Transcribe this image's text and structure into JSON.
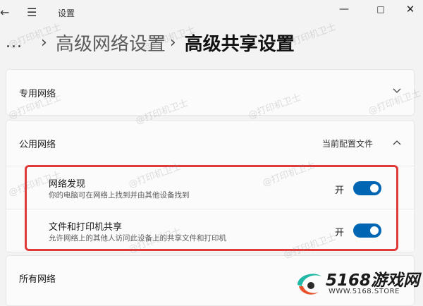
{
  "window": {
    "title": "设置"
  },
  "breadcrumb": {
    "more": "...",
    "prev": "高级网络设置",
    "current": "高级共享设置"
  },
  "private_network": {
    "label": "专用网络"
  },
  "public_network": {
    "label": "公用网络",
    "profile_status": "当前配置文件",
    "settings": [
      {
        "title": "网络发现",
        "description": "你的电脑可在网络上找到并由其他设备找到",
        "state_label": "开",
        "on": true
      },
      {
        "title": "文件和打印机共享",
        "description": "允许网络上的其他人访问此设备上的共享文件和打印机",
        "state_label": "开",
        "on": true
      }
    ]
  },
  "all_networks": {
    "label": "所有网络"
  },
  "watermark": {
    "text": "@打印机卫士"
  },
  "brand": {
    "name": "5168游戏网",
    "url": "WWW.5168.STORE"
  },
  "colors": {
    "toggle_on": "#0066b4",
    "highlight_border": "#e03a3a"
  },
  "icons": {
    "back": "arrow-left-icon",
    "menu": "hamburger-icon",
    "chevron": "chevron-icon"
  }
}
